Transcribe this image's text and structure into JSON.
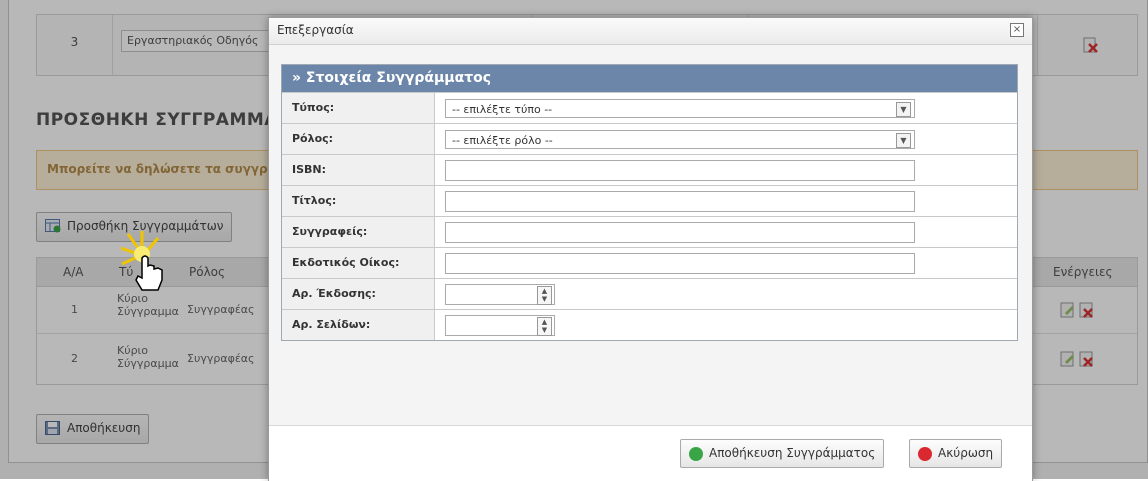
{
  "background": {
    "top_row": {
      "number": "3",
      "select_value": "Εργαστηριακός Οδηγός"
    },
    "section_title": "ΠΡΟΣΘΗΚΗ ΣΥΓΓΡΑΜΜΑ",
    "info_text": "Μπορείτε να δηλώσετε τα συγγρ",
    "add_button_label": "Προσθήκη Συγγραμμάτων",
    "grid": {
      "headers": {
        "aa": "Α/Α",
        "type": "Τύ",
        "role": "Ρόλος",
        "actions": "Ενέργειες"
      },
      "rows": [
        {
          "num": "1",
          "type": "Κύριο Σύγγραμμα",
          "role": "Συγγραφέας"
        },
        {
          "num": "2",
          "type": "Κύριο Σύγγραμμα",
          "role": "Συγγραφέας"
        }
      ]
    },
    "save_button_label": "Αποθήκευση"
  },
  "dialog": {
    "title": "Επεξεργασία",
    "close_glyph": "×",
    "section_header": "» Στοιχεία Συγγράμματος",
    "fields": {
      "type": {
        "label": "Τύπος:",
        "value": "-- επιλέξτε τύπο --"
      },
      "role": {
        "label": "Ρόλος:",
        "value": "-- επιλέξτε ρόλο --"
      },
      "isbn": {
        "label": "ISBN:"
      },
      "title": {
        "label": "Τίτλος:"
      },
      "authors": {
        "label": "Συγγραφείς:"
      },
      "publisher": {
        "label": "Εκδοτικός Οίκος:"
      },
      "edition": {
        "label": "Αρ. Έκδοσης:"
      },
      "pages": {
        "label": "Αρ. Σελίδων:"
      }
    },
    "buttons": {
      "save": "Αποθήκευση Συγγράμματος",
      "cancel": "Ακύρωση"
    }
  },
  "colors": {
    "section_header_bg": "#6b86a9",
    "info_bg": "#fdf0d6",
    "save_icon": "#3aa546",
    "cancel_icon": "#d9282f"
  }
}
